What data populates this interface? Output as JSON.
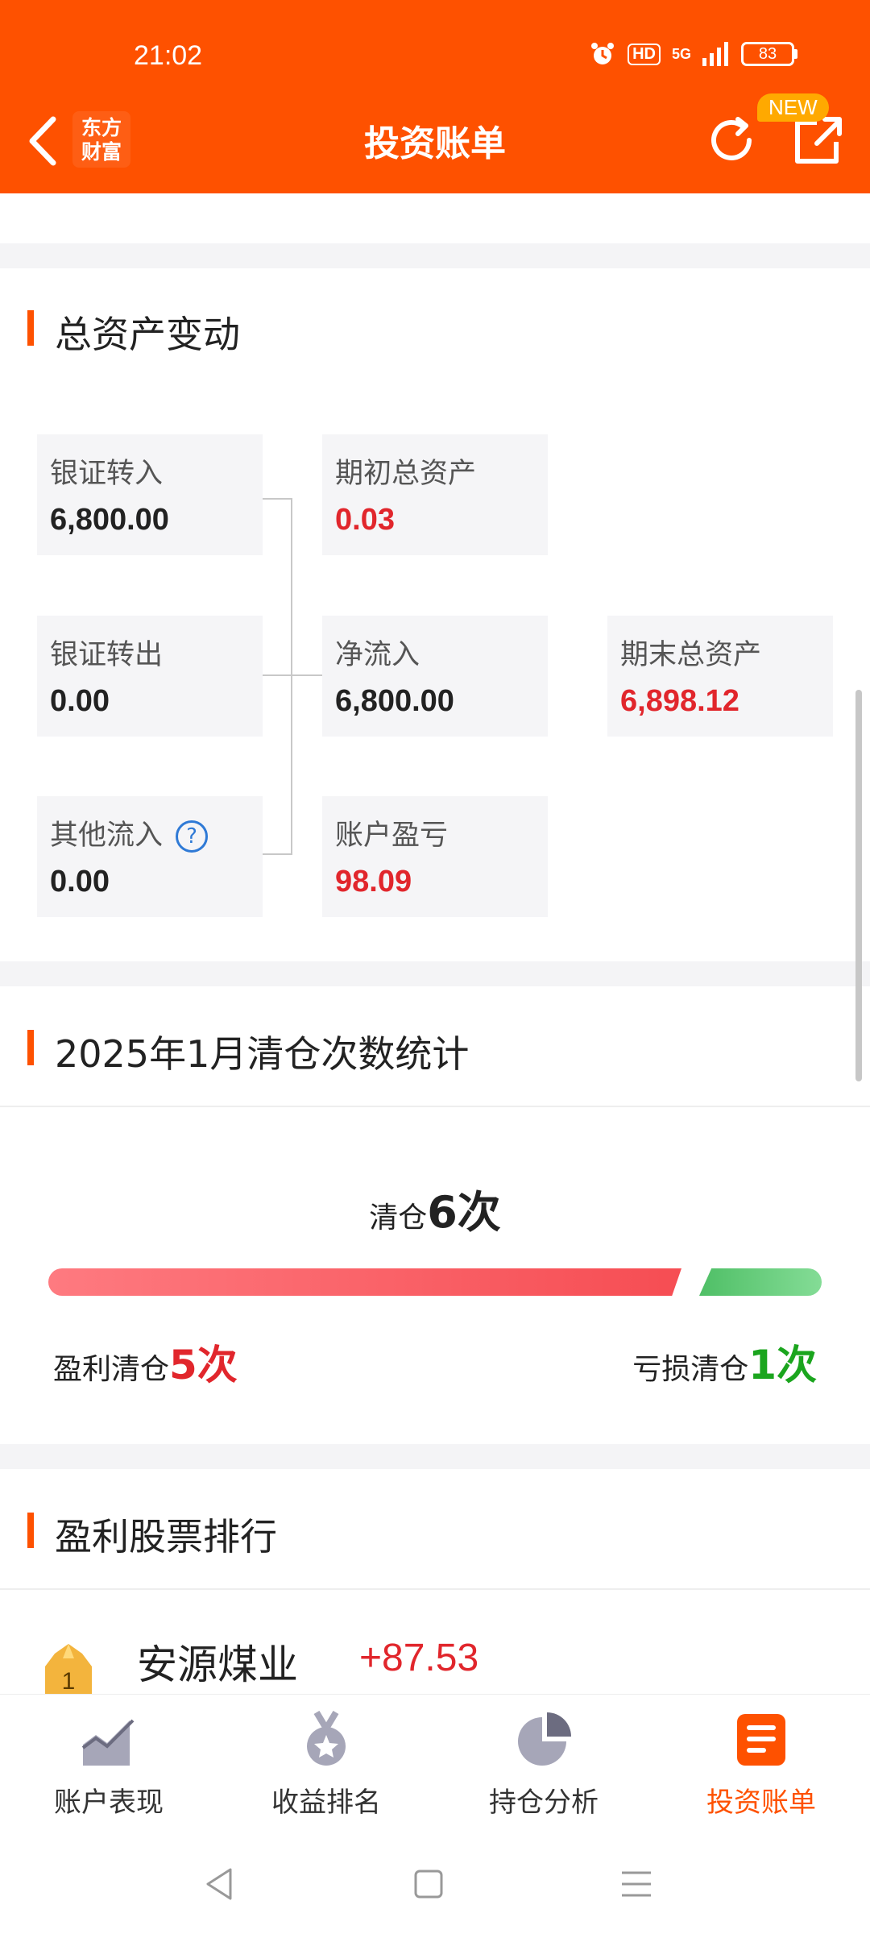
{
  "status": {
    "time": "21:02",
    "hd": "HD",
    "network": "5G",
    "battery": "83"
  },
  "nav": {
    "title": "投资账单",
    "logo_line1": "东方",
    "logo_line2": "财富",
    "new_badge": "NEW"
  },
  "assets": {
    "title": "总资产变动",
    "bank_in": {
      "label": "银证转入",
      "value": "6,800.00"
    },
    "bank_out": {
      "label": "银证转出",
      "value": "0.00"
    },
    "other_in": {
      "label": "其他流入",
      "value": "0.00",
      "help": "?"
    },
    "begin_total": {
      "label": "期初总资产",
      "value": "0.03"
    },
    "net_in": {
      "label": "净流入",
      "value": "6,800.00"
    },
    "pnl": {
      "label": "账户盈亏",
      "value": "98.09"
    },
    "end_total": {
      "label": "期末总资产",
      "value": "6,898.12"
    }
  },
  "clearing": {
    "title": "2025年1月清仓次数统计",
    "total_label": "清仓",
    "total_count": "6次",
    "profit_label": "盈利清仓",
    "profit_count": "5次",
    "loss_label": "亏损清仓",
    "loss_count": "1次",
    "profit_fraction": 0.833,
    "colors": {
      "profit": "#f64d53",
      "loss": "#4fbf66"
    }
  },
  "ranking": {
    "title": "盈利股票排行",
    "items": [
      {
        "rank": "1",
        "name": "安源煤业",
        "gain": "+87.53"
      }
    ]
  },
  "tabs": [
    {
      "label": "账户表现",
      "icon": "chart-trend-icon"
    },
    {
      "label": "收益排名",
      "icon": "medal-icon"
    },
    {
      "label": "持仓分析",
      "icon": "pie-chart-icon"
    },
    {
      "label": "投资账单",
      "icon": "bill-icon"
    }
  ],
  "colors": {
    "brand": "#fe5100",
    "red": "#e1262c",
    "green": "#1ba51e"
  }
}
